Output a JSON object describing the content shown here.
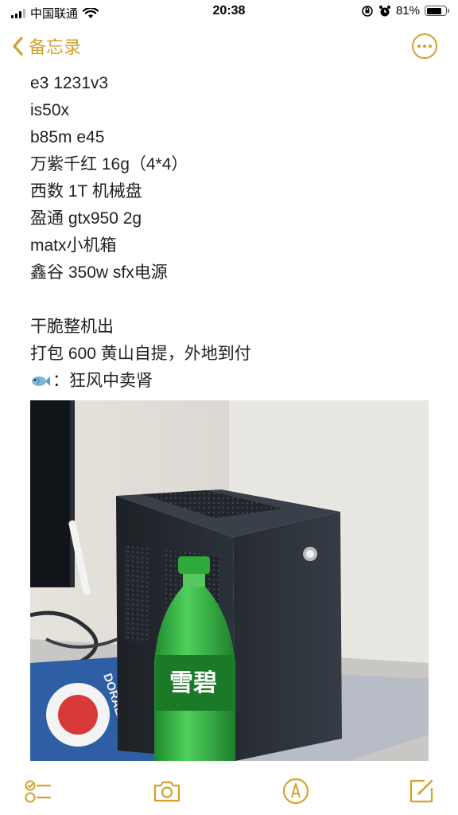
{
  "status_bar": {
    "carrier": "中国联通",
    "time": "20:38",
    "battery": "81%",
    "battery_level": 0.81
  },
  "nav": {
    "back_label": "备忘录"
  },
  "note": {
    "lines": [
      "e3 1231v3",
      "is50x",
      "b85m e45",
      "万紫千红 16g（4*4）",
      "西数 1T 机械盘",
      "盈通 gtx950 2g",
      "matx小机箱",
      "鑫谷 350w sfx电源",
      "",
      "干脆整机出",
      "打包 600 黄山自提，外地到付",
      "：狂风中卖肾"
    ]
  },
  "photo": {
    "mat_text": "DORAEMON"
  },
  "colors": {
    "accent": "#d4a12c"
  },
  "toolbar": {
    "icons": [
      "checklist-icon",
      "camera-icon",
      "markup-icon",
      "compose-icon"
    ]
  }
}
